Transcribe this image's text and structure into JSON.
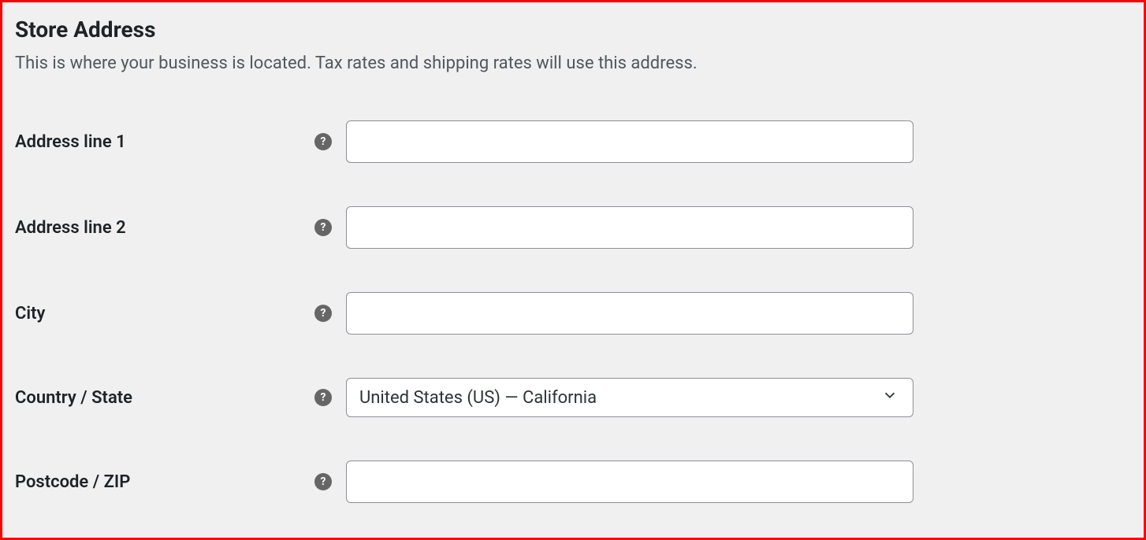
{
  "section": {
    "title": "Store Address",
    "description": "This is where your business is located. Tax rates and shipping rates will use this address."
  },
  "fields": {
    "address1": {
      "label": "Address line 1",
      "value": ""
    },
    "address2": {
      "label": "Address line 2",
      "value": ""
    },
    "city": {
      "label": "City",
      "value": ""
    },
    "country_state": {
      "label": "Country / State",
      "value": "United States (US) — California"
    },
    "postcode": {
      "label": "Postcode / ZIP",
      "value": ""
    }
  },
  "help_icon_text": "?"
}
